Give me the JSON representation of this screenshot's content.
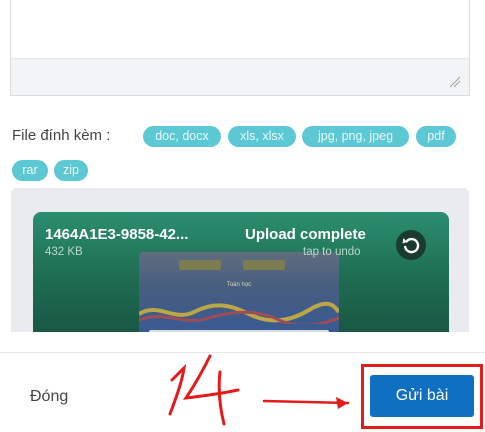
{
  "attachments": {
    "label": "File đính kèm :",
    "types": [
      "doc, docx",
      "xls, xlsx",
      "jpg, png, jpeg",
      "pdf",
      "rar",
      "zip"
    ]
  },
  "upload": {
    "file_name": "1464A1E3-9858-42...",
    "file_size": "432 KB",
    "status": "Upload complete",
    "undo_hint": "tap to undo",
    "thumbnail_caption": "Toán học"
  },
  "footer": {
    "close_label": "Đóng",
    "submit_label": "Gửi bài"
  },
  "annotation": {
    "step_number": "14",
    "color": "#e31b1b"
  },
  "colors": {
    "chip": "#5bc8d3",
    "submit": "#0f6fc1",
    "upload_card": "#2c8f6f",
    "highlight": "#e31b1b"
  }
}
